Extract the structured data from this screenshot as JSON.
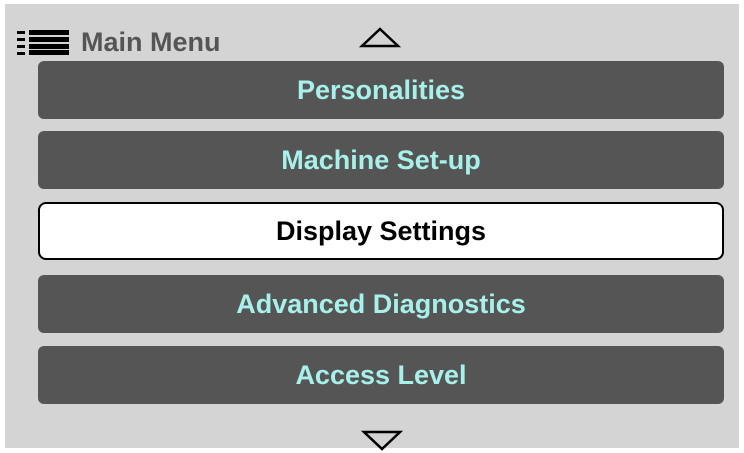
{
  "header": {
    "menu_icon": "menu-lines-icon",
    "title": "Main Menu"
  },
  "scroll": {
    "up_icon": "scroll-up-triangle-icon",
    "down_icon": "scroll-down-triangle-icon"
  },
  "menu": {
    "items": [
      {
        "label": "Personalities",
        "selected": false
      },
      {
        "label": "Machine Set-up",
        "selected": false
      },
      {
        "label": "Display Settings",
        "selected": true
      },
      {
        "label": "Advanced Diagnostics",
        "selected": false
      },
      {
        "label": "Access Level",
        "selected": false
      }
    ]
  },
  "colors": {
    "screen_background": "#d4d4d4",
    "item_background": "#555555",
    "item_text": "#a8f1ea",
    "selected_background": "#ffffff",
    "selected_text": "#000000"
  }
}
